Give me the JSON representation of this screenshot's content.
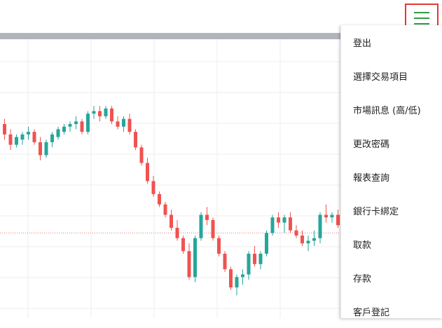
{
  "colors": {
    "up": "#26a69a",
    "down": "#ef5350",
    "grid": "#eeeeee",
    "reference_line": "#e57373",
    "menu_icon": "#2e9e3f",
    "highlight_border": "#e53935"
  },
  "menu_button": {
    "icon": "hamburger-menu-icon"
  },
  "menu": {
    "items": [
      {
        "label": "登出"
      },
      {
        "label": "選擇交易項目"
      },
      {
        "label": "市場訊息 (高/低)"
      },
      {
        "label": "更改密碼"
      },
      {
        "label": "報表查詢"
      },
      {
        "label": "銀行卡綁定"
      },
      {
        "label": "取款"
      },
      {
        "label": "存款"
      },
      {
        "label": "客戶登記"
      }
    ]
  },
  "chart_data": {
    "type": "candlestick",
    "ylim": [
      0,
      100
    ],
    "reference_value": 28,
    "grid": true,
    "candles": [
      [
        70,
        72,
        64,
        66
      ],
      [
        66,
        68,
        60,
        62
      ],
      [
        62,
        66,
        61,
        65
      ],
      [
        64,
        67,
        62,
        66
      ],
      [
        66,
        69,
        64,
        67
      ],
      [
        67,
        68,
        62,
        63
      ],
      [
        63,
        65,
        56,
        58
      ],
      [
        58,
        64,
        57,
        63
      ],
      [
        63,
        67,
        61,
        66
      ],
      [
        65,
        69,
        64,
        68
      ],
      [
        67,
        70,
        66,
        69
      ],
      [
        69,
        71,
        67,
        70
      ],
      [
        70,
        73,
        68,
        71
      ],
      [
        71,
        72,
        66,
        67
      ],
      [
        67,
        75,
        66,
        74
      ],
      [
        74,
        77,
        72,
        75
      ],
      [
        75,
        77,
        71,
        73
      ],
      [
        73,
        77,
        72,
        76
      ],
      [
        76,
        77,
        70,
        71
      ],
      [
        71,
        73,
        68,
        69
      ],
      [
        69,
        73,
        67,
        72
      ],
      [
        72,
        74,
        66,
        67
      ],
      [
        67,
        68,
        60,
        61
      ],
      [
        61,
        62,
        54,
        55
      ],
      [
        55,
        57,
        47,
        48
      ],
      [
        48,
        50,
        42,
        43
      ],
      [
        43,
        44,
        38,
        39
      ],
      [
        39,
        40,
        34,
        35
      ],
      [
        35,
        37,
        29,
        30
      ],
      [
        30,
        33,
        25,
        26
      ],
      [
        26,
        27,
        20,
        21
      ],
      [
        21,
        24,
        10,
        11
      ],
      [
        11,
        27,
        9,
        26
      ],
      [
        26,
        36,
        25,
        35
      ],
      [
        35,
        38,
        31,
        33
      ],
      [
        33,
        34,
        25,
        26
      ],
      [
        26,
        27,
        19,
        20
      ],
      [
        20,
        21,
        13,
        14
      ],
      [
        14,
        15,
        6,
        7
      ],
      [
        7,
        12,
        4,
        11
      ],
      [
        11,
        14,
        8,
        12
      ],
      [
        12,
        21,
        10,
        20
      ],
      [
        20,
        23,
        15,
        16
      ],
      [
        16,
        21,
        14,
        20
      ],
      [
        20,
        29,
        19,
        28
      ],
      [
        28,
        35,
        27,
        34
      ],
      [
        34,
        36,
        30,
        32
      ],
      [
        32,
        35,
        28,
        34
      ],
      [
        34,
        36,
        28,
        29
      ],
      [
        29,
        31,
        26,
        27
      ],
      [
        27,
        29,
        23,
        24
      ],
      [
        24,
        27,
        21,
        25
      ],
      [
        25,
        29,
        23,
        26
      ],
      [
        26,
        36,
        24,
        35
      ],
      [
        35,
        39,
        32,
        34
      ],
      [
        34,
        36,
        32,
        35
      ],
      [
        35,
        37,
        30,
        31
      ]
    ]
  }
}
